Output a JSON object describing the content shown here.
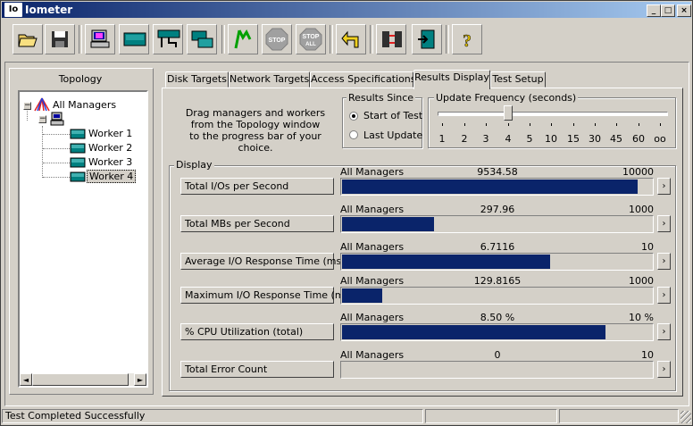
{
  "window": {
    "title": "Iometer",
    "icon_text": "Io",
    "minimize": "_",
    "maximize": "□",
    "close": "×"
  },
  "toolbar": {
    "buttons": [
      {
        "name": "open-config-button",
        "icon": "folder-open-icon"
      },
      {
        "name": "save-config-button",
        "icon": "floppy-disk-icon"
      },
      {
        "name": "start-new-manager-button",
        "icon": "computer-icon"
      },
      {
        "name": "start-disk-worker-button",
        "icon": "disk-worker-icon"
      },
      {
        "name": "start-network-worker-button",
        "icon": "network-worker-icon"
      },
      {
        "name": "duplicate-worker-button",
        "icon": "duplicate-worker-icon"
      },
      {
        "name": "start-tests-button",
        "icon": "green-flag-icon"
      },
      {
        "name": "stop-current-test-button",
        "icon": "stop-sign-icon",
        "text": "STOP"
      },
      {
        "name": "abort-all-tests-button",
        "icon": "stop-all-sign-icon",
        "text": "STOP",
        "text2": "ALL"
      },
      {
        "name": "reset-workers-button",
        "icon": "reset-arrow-icon"
      },
      {
        "name": "disconnect-managers-button",
        "icon": "disconnect-icon"
      },
      {
        "name": "exit-button",
        "icon": "exit-door-icon"
      },
      {
        "name": "about-button",
        "icon": "help-question-icon",
        "text": "?"
      }
    ]
  },
  "topology": {
    "title": "Topology",
    "root": "All Managers",
    "workers": [
      "Worker 1",
      "Worker 2",
      "Worker 3",
      "Worker 4"
    ],
    "selected_worker": "Worker 4",
    "scroll_left": "◄",
    "scroll_right": "►"
  },
  "tabs": [
    "Disk Targets",
    "Network Targets",
    "Access Specifications",
    "Results Display",
    "Test Setup"
  ],
  "active_tab": "Results Display",
  "instructions": [
    "Drag managers and workers",
    "from the Topology window",
    "to the progress bar of your choice."
  ],
  "results_since": {
    "label": "Results Since",
    "options": [
      "Start of Test",
      "Last Update"
    ],
    "selected": "Start of Test"
  },
  "update_frequency": {
    "label": "Update Frequency (seconds)",
    "ticks": [
      "1",
      "2",
      "3",
      "4",
      "5",
      "10",
      "15",
      "30",
      "45",
      "60",
      "oo"
    ],
    "selected": "4"
  },
  "display": {
    "label": "Display",
    "rows": [
      {
        "metric": "Total I/Os per Second",
        "source": "All Managers",
        "value": "9534.58",
        "max": "10000",
        "fraction": 0.9535
      },
      {
        "metric": "Total MBs per Second",
        "source": "All Managers",
        "value": "297.96",
        "max": "1000",
        "fraction": 0.298
      },
      {
        "metric": "Average I/O Response Time (ms)",
        "source": "All Managers",
        "value": "6.7116",
        "max": "10",
        "fraction": 0.6712
      },
      {
        "metric": "Maximum I/O Response Time (ms)",
        "source": "All Managers",
        "value": "129.8165",
        "max": "1000",
        "fraction": 0.1298
      },
      {
        "metric": "% CPU Utilization (total)",
        "source": "All Managers",
        "value": "8.50 %",
        "max": "10 %",
        "fraction": 0.85
      },
      {
        "metric": "Total Error Count",
        "source": "All Managers",
        "value": "0",
        "max": "10",
        "fraction": 0
      }
    ],
    "arrow": "›"
  },
  "status_bar": {
    "message": "Test Completed Successfully"
  },
  "colors": {
    "title_start": "#0a246a",
    "title_end": "#a6caf0",
    "bar": "#0a246a",
    "face": "#d4d0c8"
  }
}
